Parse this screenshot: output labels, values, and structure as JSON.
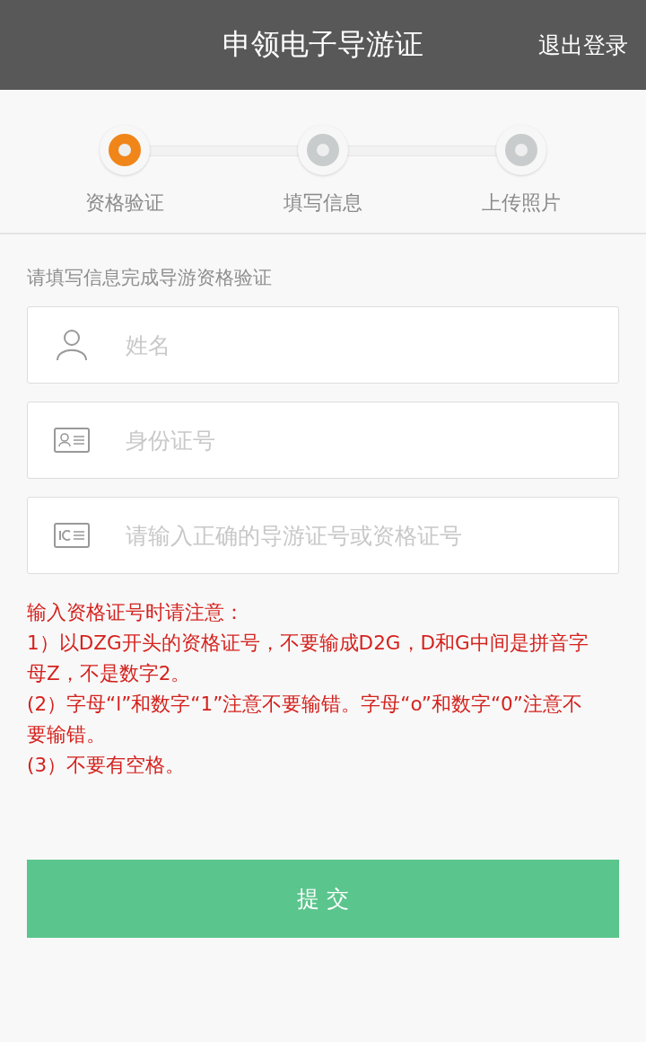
{
  "header": {
    "title": "申领电子导游证",
    "logout": "退出登录"
  },
  "steps": [
    {
      "label": "资格验证",
      "selected": true
    },
    {
      "label": "填写信息",
      "selected": false
    },
    {
      "label": "上传照片",
      "selected": false
    }
  ],
  "hint": "请填写信息完成导游资格验证",
  "fields": [
    {
      "kind": "person",
      "placeholder": "姓名"
    },
    {
      "kind": "idcard",
      "placeholder": "身份证号"
    },
    {
      "kind": "ic",
      "placeholder": "请输入正确的导游证号或资格证号"
    }
  ],
  "notes": [
    "输入资格证号时请注意：",
    "1）以DZG开头的资格证号，不要输成D2G，D和G中间是拼音字母Z，不是数字2。",
    "(2）字母“l”和数字“1”注意不要输错。字母“o”和数字“0”注意不要输错。",
    "(3）不要有空格。"
  ],
  "submit": "提 交"
}
